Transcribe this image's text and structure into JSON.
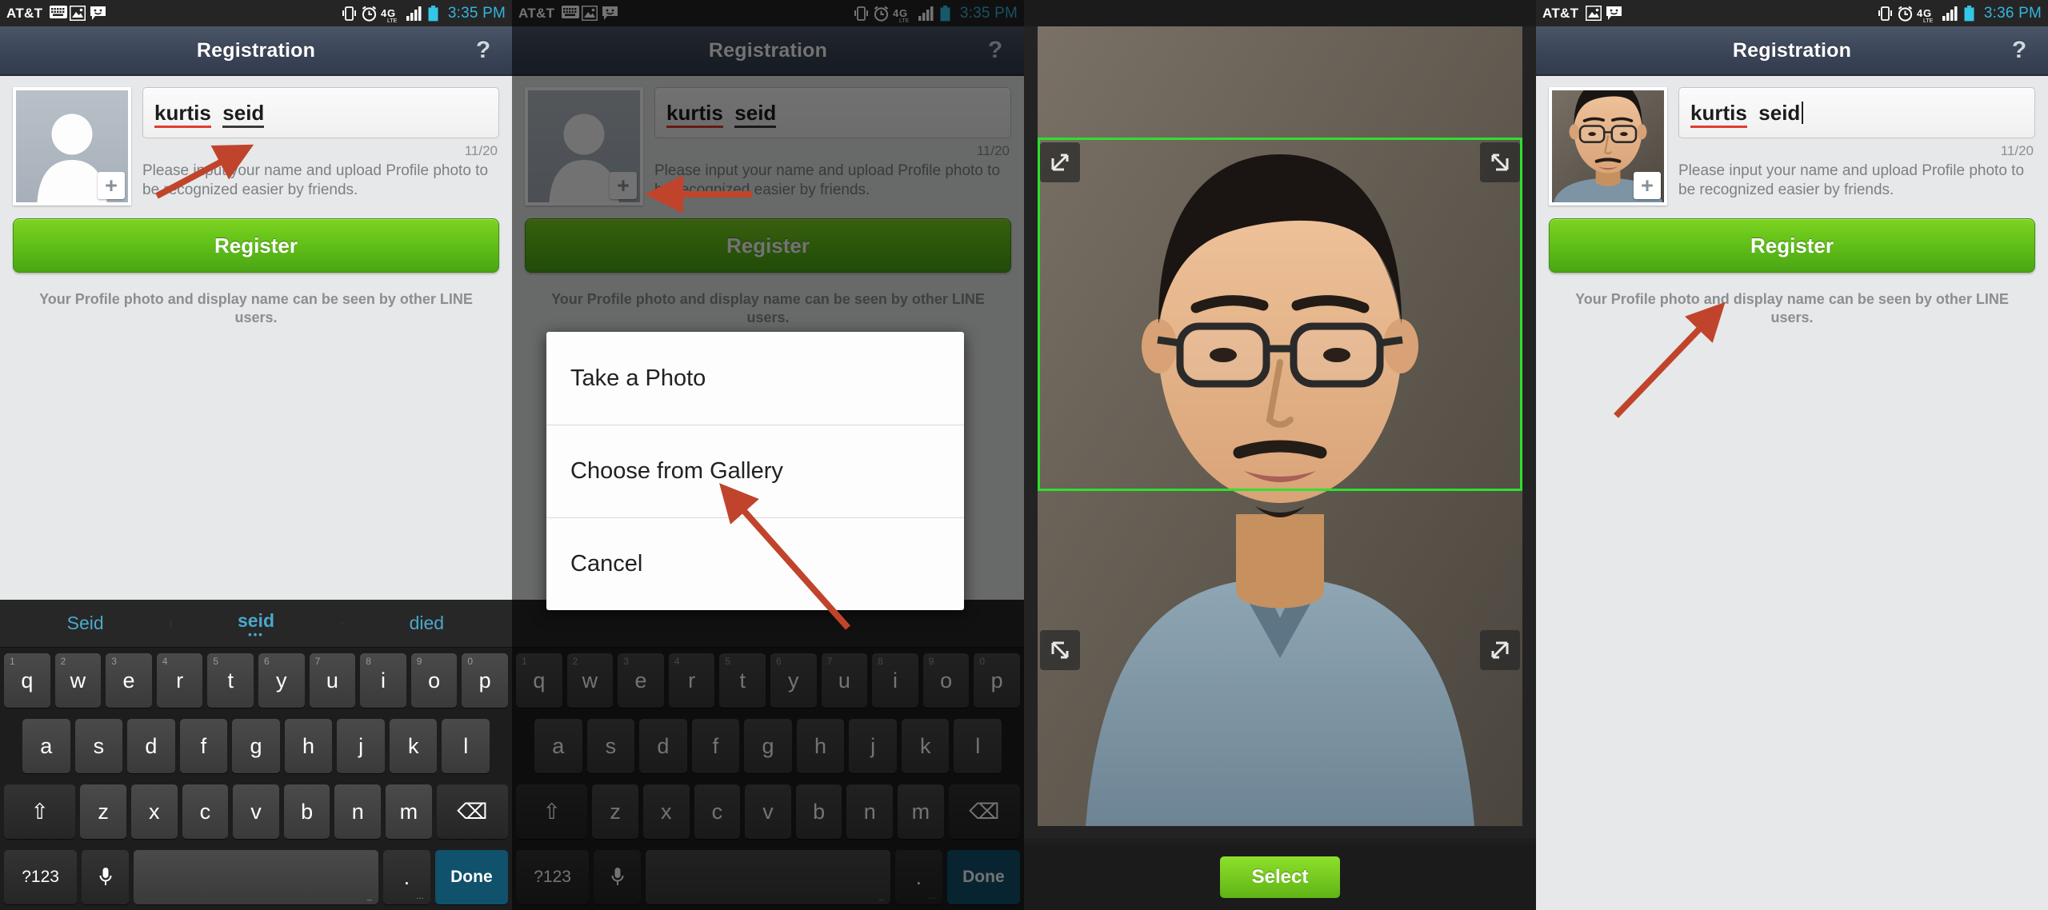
{
  "status_bar": {
    "carrier": "AT&T",
    "icons": [
      "keyboard-icon",
      "image-icon",
      "message-icon"
    ],
    "right_icons": [
      "vibrate-icon",
      "alarm-icon",
      "4glte-icon",
      "signal-icon",
      "battery-icon"
    ],
    "network": "4G",
    "network_sub": "LTE",
    "time_1": "3:35 PM",
    "time_2": "3:35 PM",
    "time_4": "3:36 PM",
    "accent_time_color": "#35b4de"
  },
  "title_bar": {
    "title": "Registration",
    "help_label": "?"
  },
  "form": {
    "name_part_misspelled": "kurtis",
    "name_part_ok": "seid",
    "char_counter": "11/20",
    "hint": "Please input your name and upload Profile photo to be recognized easier by friends.",
    "register_label": "Register",
    "footnote": "Your Profile photo and display name can be seen by other LINE users.",
    "avatar_plus": "+",
    "avatar_name": "avatar-placeholder"
  },
  "dialog": {
    "items": [
      {
        "label": "Take a Photo",
        "name": "dialog-take-photo"
      },
      {
        "label": "Choose from Gallery",
        "name": "dialog-choose-gallery"
      },
      {
        "label": "Cancel",
        "name": "dialog-cancel"
      }
    ]
  },
  "crop_screen": {
    "select_label": "Select",
    "crop_border_color": "#2ee02e",
    "handles": [
      "resize-handle-top-left",
      "resize-handle-top-right",
      "resize-handle-bottom-left",
      "resize-handle-bottom-right"
    ]
  },
  "keyboard": {
    "suggestions": [
      {
        "label": "Seid",
        "active": false
      },
      {
        "label": "seid",
        "active": true
      },
      {
        "label": "died",
        "active": false
      }
    ],
    "row1": [
      {
        "k": "q",
        "n": "1"
      },
      {
        "k": "w",
        "n": "2"
      },
      {
        "k": "e",
        "n": "3"
      },
      {
        "k": "r",
        "n": "4"
      },
      {
        "k": "t",
        "n": "5"
      },
      {
        "k": "y",
        "n": "6"
      },
      {
        "k": "u",
        "n": "7"
      },
      {
        "k": "i",
        "n": "8"
      },
      {
        "k": "o",
        "n": "9"
      },
      {
        "k": "p",
        "n": "0"
      }
    ],
    "row2": [
      "a",
      "s",
      "d",
      "f",
      "g",
      "h",
      "j",
      "k",
      "l"
    ],
    "row3": [
      "z",
      "x",
      "c",
      "v",
      "b",
      "n",
      "m"
    ],
    "shift_label": "⇧",
    "backspace_label": "⌫",
    "symbols_label": "?123",
    "mic_label": "mic-icon",
    "space_label": "",
    "period_label": ".",
    "done_label": "Done"
  },
  "annotations": {
    "arrow_color": "#c0442b",
    "arrows": [
      {
        "name": "arrow-to-name-field",
        "panel": 1
      },
      {
        "name": "arrow-to-avatar",
        "panel": 2
      },
      {
        "name": "arrow-to-choose-gallery",
        "panel": 2
      },
      {
        "name": "arrow-to-register-button",
        "panel": 4
      }
    ]
  },
  "panels": [
    {
      "index": 1,
      "name": "panel-name-entry"
    },
    {
      "index": 2,
      "name": "panel-photo-source-dialog"
    },
    {
      "index": 3,
      "name": "panel-photo-crop"
    },
    {
      "index": 4,
      "name": "panel-registration-complete"
    }
  ]
}
